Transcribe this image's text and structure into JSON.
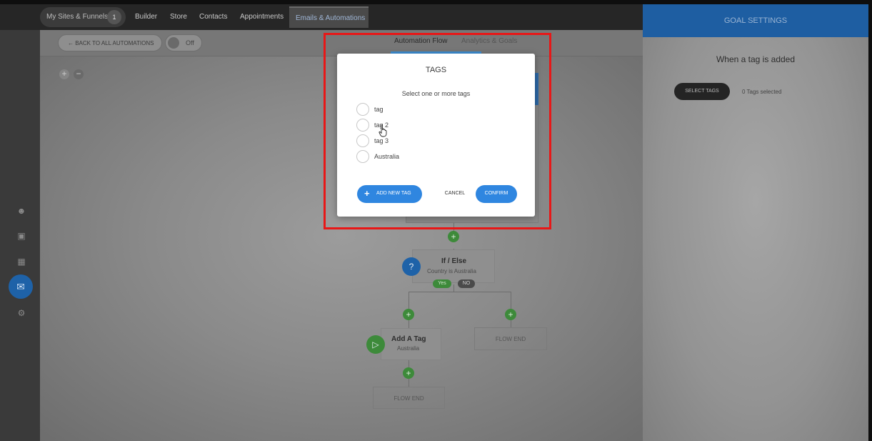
{
  "topnav": {
    "sites_funnels": "My Sites & Funnels",
    "sites_badge": "1",
    "items": [
      "Builder",
      "Store",
      "Contacts",
      "Appointments"
    ],
    "active": "Emails & Automations"
  },
  "subbar": {
    "back_label": "← BACK TO ALL AUTOMATIONS",
    "toggle_label": "Off",
    "tabs": [
      "Automation Flow",
      "Analytics & Goals"
    ],
    "active_tab": "Automation Flow"
  },
  "flow": {
    "if_else": {
      "title": "If / Else",
      "subtitle": "Country is Australia",
      "yes": "Yes",
      "no": "NO"
    },
    "add_tag": {
      "title": "Add A Tag",
      "subtitle": "Australia"
    },
    "flow_end_right": "FLOW END",
    "flow_end_bottom": "FLOW END"
  },
  "right_panel": {
    "header": "GOAL SETTINGS",
    "goal_title": "When a tag is added",
    "select_tags": "SELECT TAGS",
    "tags_count": "0 Tags selected"
  },
  "modal": {
    "title": "TAGS",
    "subtitle": "Select one or more tags",
    "options": [
      "tag",
      "tag 2",
      "tag 3",
      "Australia"
    ],
    "add_new_tag": "ADD NEW TAG",
    "cancel": "CANCEL",
    "confirm": "CONFIRM"
  },
  "colors": {
    "accent": "#2f86e0",
    "header_blue": "#1e5ea2",
    "highlight": "#e81717",
    "green": "#3d8a3a"
  }
}
